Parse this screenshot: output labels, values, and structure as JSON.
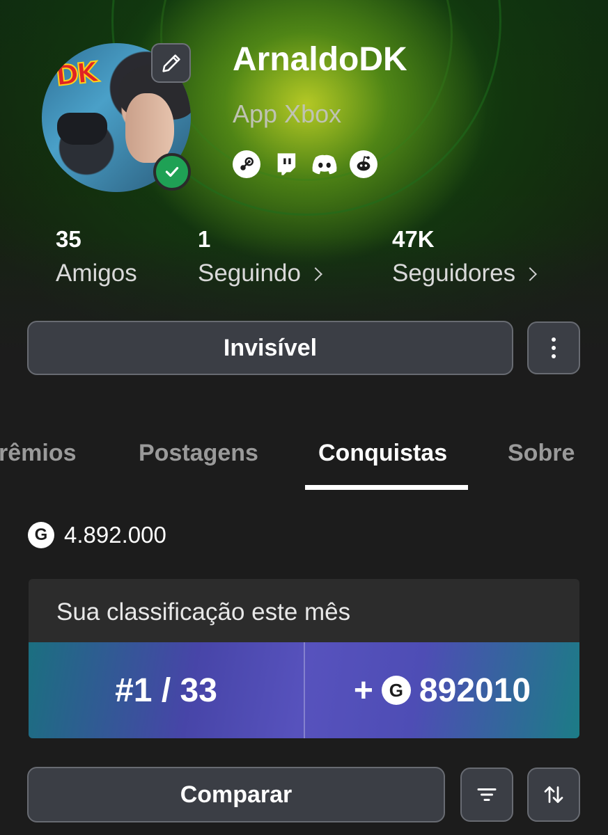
{
  "profile": {
    "username": "ArnaldoDK",
    "subtitle": "App Xbox",
    "avatar_logo_text": "DK",
    "edit_icon": "pencil-icon",
    "verified_icon": "checkmark-icon",
    "social_icons": [
      "steam-icon",
      "twitch-icon",
      "discord-icon",
      "reddit-icon"
    ]
  },
  "stats": {
    "friends": {
      "value": "35",
      "label": "Amigos"
    },
    "following": {
      "value": "1",
      "label": "Seguindo"
    },
    "followers": {
      "value": "47K",
      "label": "Seguidores"
    }
  },
  "actions": {
    "status_label": "Invisível",
    "more_icon": "more-vertical-icon"
  },
  "tabs": [
    {
      "label": "Prêmios",
      "visible_text": "rêmios",
      "active": false
    },
    {
      "label": "Postagens",
      "active": false
    },
    {
      "label": "Conquistas",
      "active": true
    },
    {
      "label": "Sobre",
      "active": false
    }
  ],
  "gamerscore": {
    "icon": "G",
    "total": "4.892.000"
  },
  "ranking": {
    "title": "Sua classificação este mês",
    "position": "#1 / 33",
    "gain_prefix": "+",
    "gain_icon": "G",
    "gain_value": "892010"
  },
  "bottom": {
    "compare_label": "Comparar",
    "filter_icon": "filter-icon",
    "sort_icon": "sort-icon"
  },
  "colors": {
    "background": "#1c1c1c",
    "button_bg": "#3b3e45",
    "verified_green": "#1fa155",
    "rank_gradient_purple": "#5752bd",
    "rank_gradient_teal": "#1b6f80"
  }
}
